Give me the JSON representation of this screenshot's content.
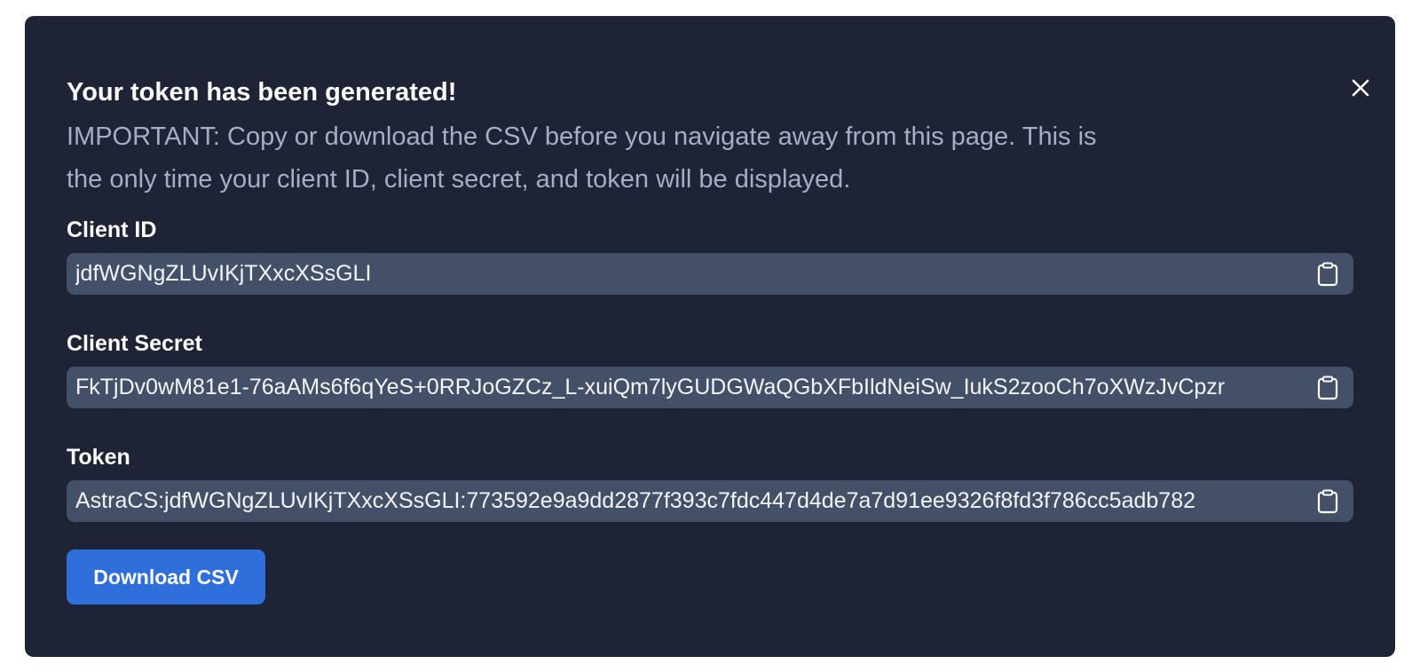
{
  "dialog": {
    "title": "Your token has been generated!",
    "notice_lines": [
      "IMPORTANT: Copy or download the CSV before you navigate away from this page. This is",
      "the only time your client ID, client secret, and token will be displayed."
    ],
    "close_icon": "close-icon"
  },
  "fields": {
    "client_id": {
      "label": "Client ID",
      "value": "jdfWGNgZLUvIKjTXxcXSsGLI",
      "icon": "clipboard-icon"
    },
    "client_secret": {
      "label": "Client Secret",
      "value": "FkTjDv0wM81e1-76aAMs6f6qYeS+0RRJoGZCz_L-xuiQm7lyGUDGWaQGbXFbIldNeiSw_IukS2zooCh7oXWzJvCpzr",
      "icon": "clipboard-icon"
    },
    "token": {
      "label": "Token",
      "value": "AstraCS:jdfWGNgZLUvIKjTXxcXSsGLI:773592e9a9dd2877f393c7fdc447d4de7a7d91ee9326f8fd3f786cc5adb782",
      "icon": "clipboard-icon"
    }
  },
  "actions": {
    "download_label": "Download CSV"
  },
  "colors": {
    "panel_background": "#1f2336",
    "field_background": "#444f68",
    "notice_text": "#a5aec2",
    "primary_button": "#2f6fdc"
  }
}
